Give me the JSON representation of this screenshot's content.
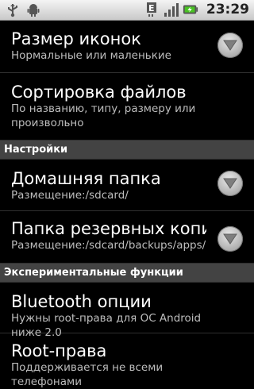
{
  "status_bar": {
    "time": "23:29",
    "left_icons": [
      "usb-icon",
      "android-icon"
    ],
    "right_icons": [
      "data-e-icon",
      "signal-icon",
      "battery-icon"
    ],
    "network_type": "E"
  },
  "prefs": [
    {
      "title": "Размер иконок",
      "summary": "Нормальные или маленькие",
      "has_dropdown": true
    },
    {
      "title": "Сортировка файлов",
      "summary": "По названию, типу, размеру или произвольно",
      "has_dropdown": false
    }
  ],
  "section_settings": "Настройки",
  "settings_prefs": [
    {
      "title": "Домашняя папка",
      "summary": "Размещение:/sdcard/",
      "has_dropdown": true
    },
    {
      "title": "Папка резервных копий",
      "summary": "Размещение:/sdcard/backups/apps/",
      "has_dropdown": true
    }
  ],
  "section_experimental": "Экспериментальные функции",
  "experimental_prefs": [
    {
      "title": "Bluetooth опции",
      "summary": "Нужны root-права для ОС Android ниже 2.0"
    },
    {
      "title": "Root-права",
      "summary": "Поддерживается не всеми телефонами"
    }
  ],
  "colors": {
    "background": "#000000",
    "header_bg": "#434343",
    "summary_text": "#bdbdbd"
  }
}
